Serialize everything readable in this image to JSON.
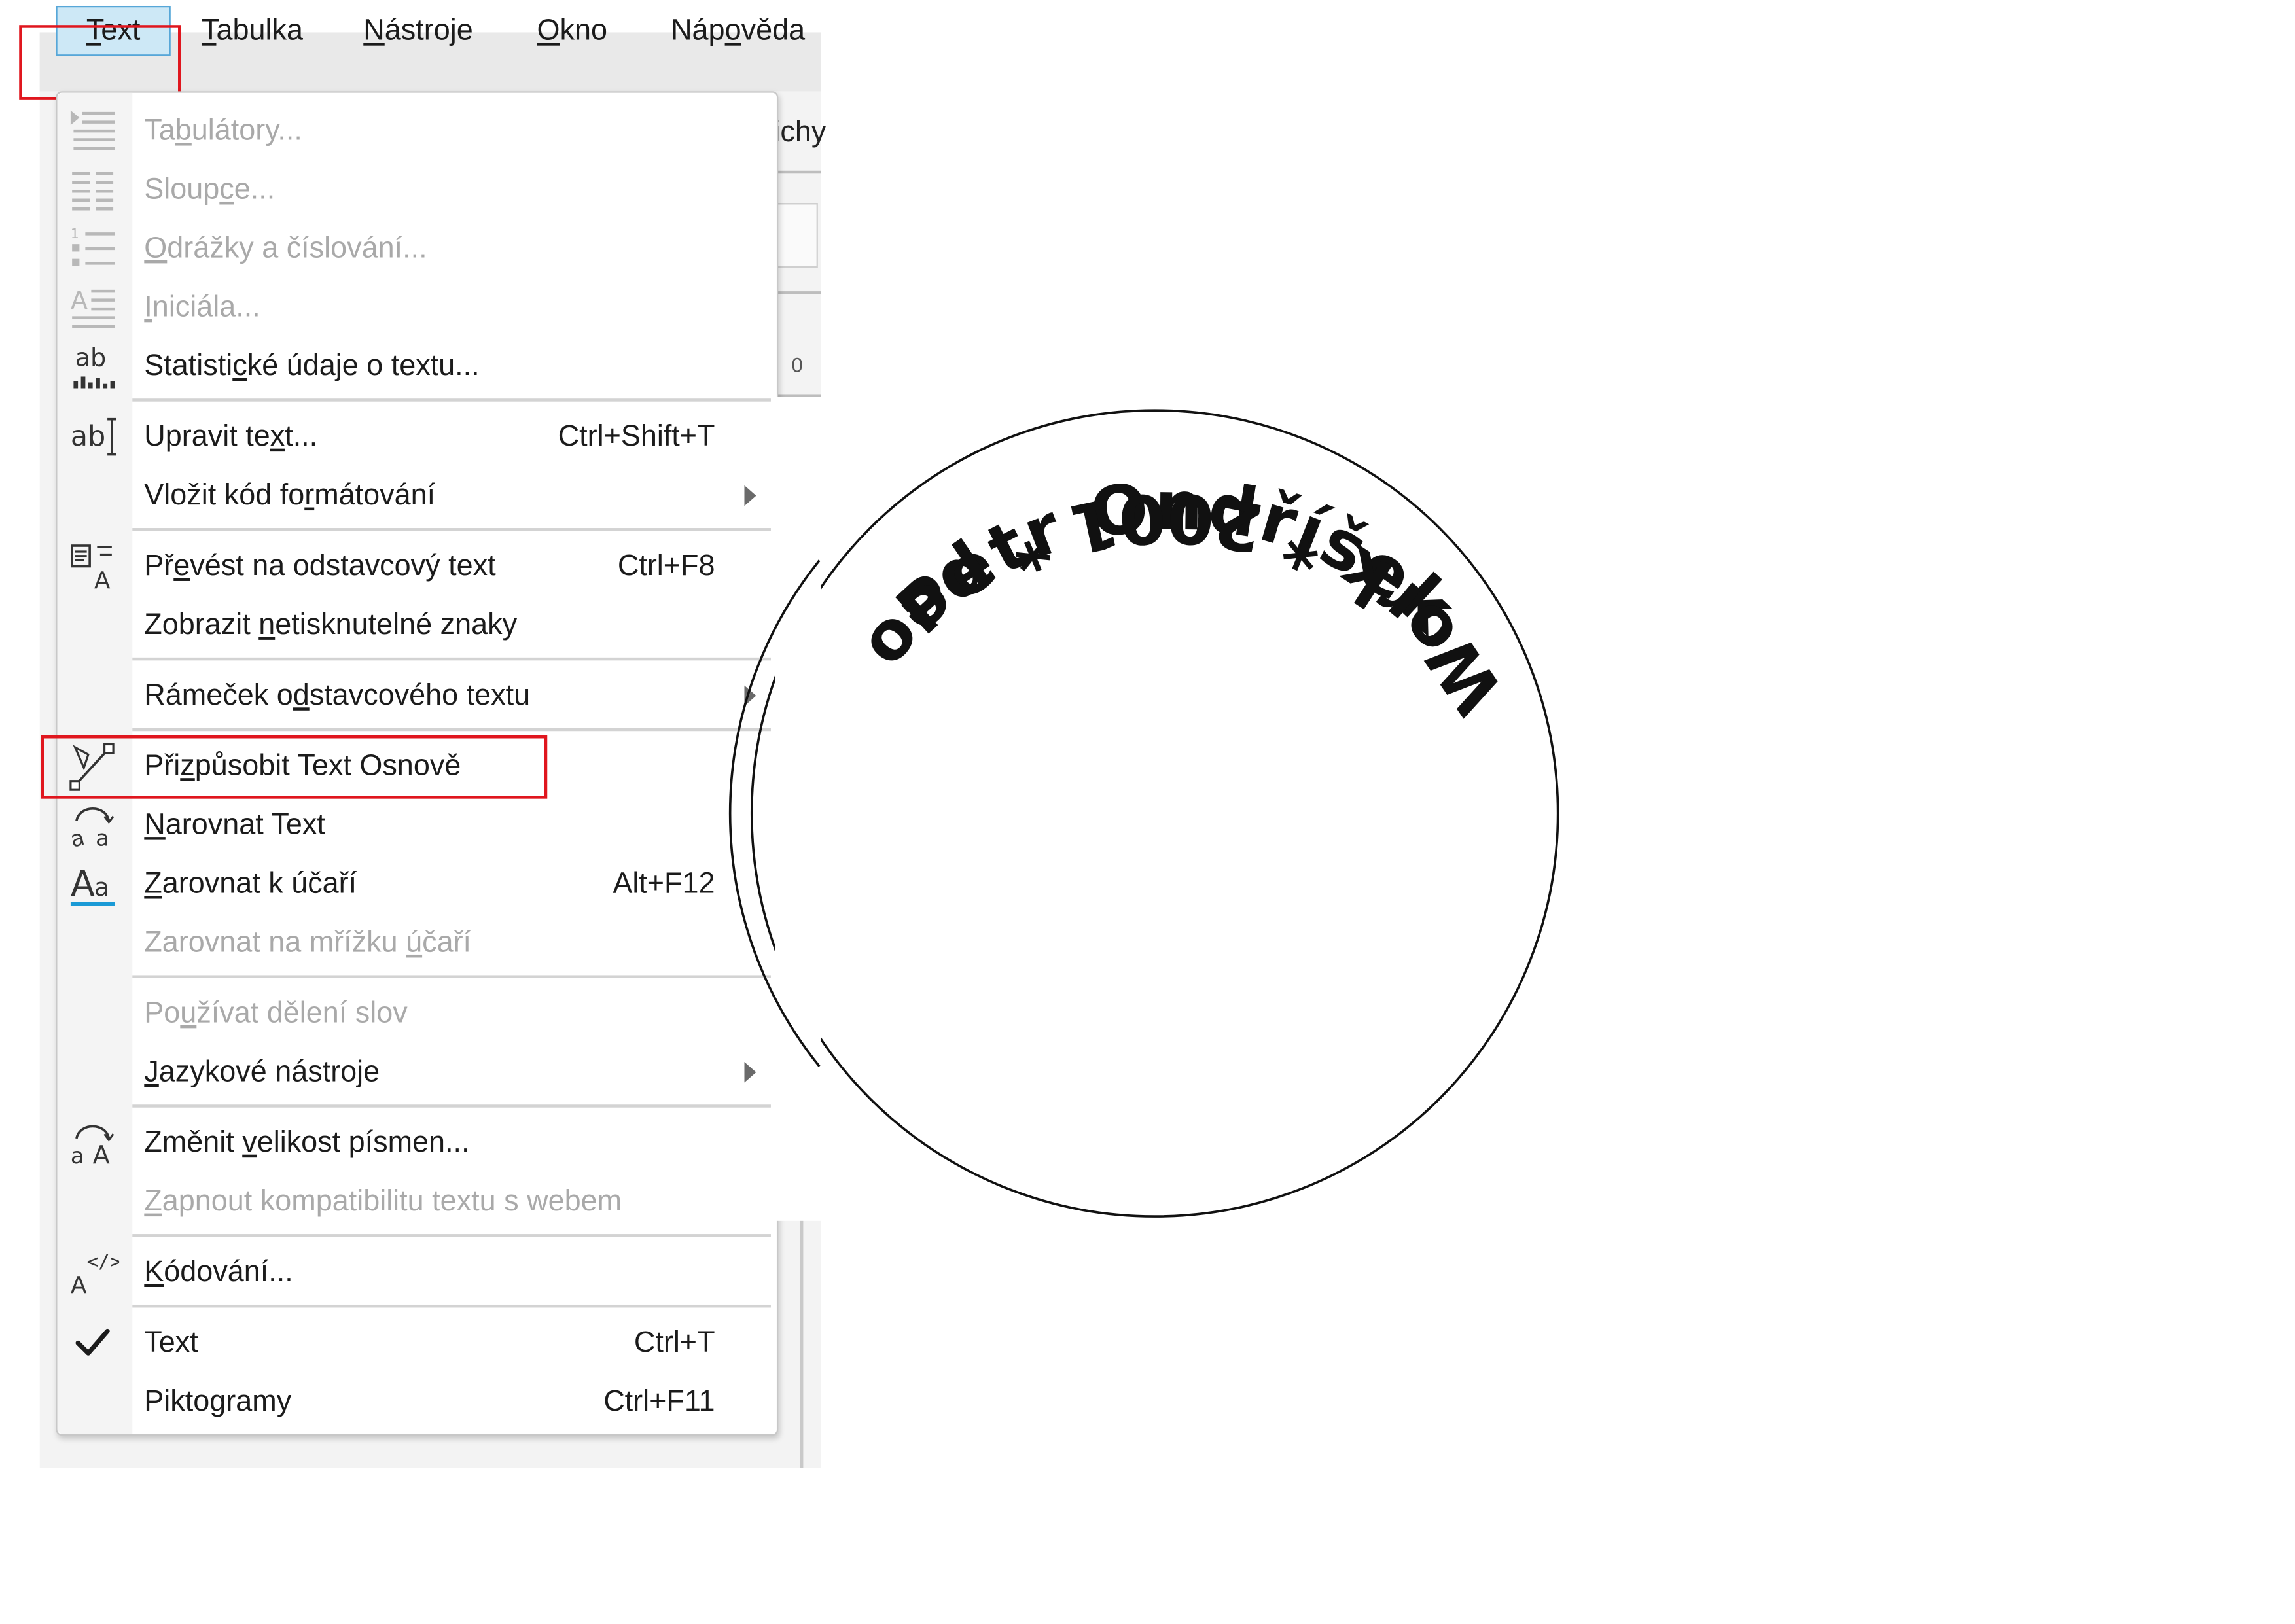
{
  "menubar": {
    "items": [
      {
        "label": "Text",
        "underline": "T",
        "rest": "ext"
      },
      {
        "label": "Tabulka",
        "underline": "T",
        "rest": "abulka"
      },
      {
        "label": "Nástroje",
        "underline": "N",
        "rest": "ástroje"
      },
      {
        "label": "Okno",
        "underline": "O",
        "rest": "kno"
      },
      {
        "label": "Nápověda",
        "pre": "Náp",
        "underline": "o",
        "rest": "věda"
      }
    ]
  },
  "behind": {
    "partial_word": "ichy",
    "ruler_zero": "0"
  },
  "menu": {
    "items": [
      {
        "pre": "Ta",
        "u": "b",
        "post": "ulátory...",
        "shortcut": ""
      },
      {
        "pre": "Sloup",
        "u": "c",
        "post": "e...",
        "shortcut": ""
      },
      {
        "pre": "",
        "u": "O",
        "post": "drážky a číslování...",
        "shortcut": ""
      },
      {
        "pre": "",
        "u": "I",
        "post": "niciála...",
        "shortcut": ""
      },
      {
        "pre": "Statisti",
        "u": "c",
        "post": "ké údaje o textu...",
        "shortcut": ""
      },
      {
        "pre": "Upravit te",
        "u": "x",
        "post": "t...",
        "shortcut": "Ctrl+Shift+T"
      },
      {
        "pre": "Vložit kód fo",
        "u": "r",
        "post": "mátování",
        "shortcut": ""
      },
      {
        "pre": "Př",
        "u": "e",
        "post": "vést na odstavcový text",
        "shortcut": "Ctrl+F8"
      },
      {
        "pre": "Zobrazit ",
        "u": "n",
        "post": "etisknutelné znaky",
        "shortcut": ""
      },
      {
        "pre": "Rámeček o",
        "u": "d",
        "post": "stavcového textu",
        "shortcut": ""
      },
      {
        "pre": "Při",
        "u": "z",
        "post": "působit Text Osnově",
        "shortcut": ""
      },
      {
        "pre": "",
        "u": "N",
        "post": "arovnat Text",
        "shortcut": ""
      },
      {
        "pre": "",
        "u": "Z",
        "post": "arovnat k účaří",
        "shortcut": "Alt+F12"
      },
      {
        "pre": "Zarovnat na mřížku ",
        "u": "ú",
        "post": "čaří",
        "shortcut": ""
      },
      {
        "pre": "Po",
        "u": "u",
        "post": "žívat dělení slov",
        "shortcut": ""
      },
      {
        "pre": "",
        "u": "J",
        "post": "azykové nástroje",
        "shortcut": ""
      },
      {
        "pre": "Změnit ",
        "u": "v",
        "post": "elikost písmen...",
        "shortcut": ""
      },
      {
        "pre": "",
        "u": "Z",
        "post": "apnout kompatibilitu textu s webem",
        "shortcut": ""
      },
      {
        "pre": "",
        "u": "K",
        "post": "ódování...",
        "shortcut": ""
      },
      {
        "pre": "Text",
        "u": "",
        "post": "",
        "shortcut": "Ctrl+T"
      },
      {
        "pre": "Piktogramy",
        "u": "",
        "post": "",
        "shortcut": "Ctrl+F11"
      }
    ]
  },
  "icons": {
    "tabs": "tab-stops-icon",
    "columns": "columns-icon",
    "bullets": "bullets-numbering-icon",
    "dropcap": "drop-cap-icon",
    "stats": "text-statistics-icon",
    "edit": "edit-text-icon",
    "convert": "convert-paragraph-text-icon",
    "fit": "fit-text-to-path-icon",
    "straighten": "straighten-text-icon",
    "baseline": "align-to-baseline-icon",
    "case": "change-case-icon",
    "encoding": "encoding-icon",
    "check": "check-icon"
  },
  "artwork": {
    "top_text": "Petr Ondříšek",
    "bottom_text": "Work * 2001 * peon"
  },
  "colors": {
    "highlight": "#e0161e",
    "menu_selection": "#cde8f6",
    "accent": "#1a9ad6"
  }
}
